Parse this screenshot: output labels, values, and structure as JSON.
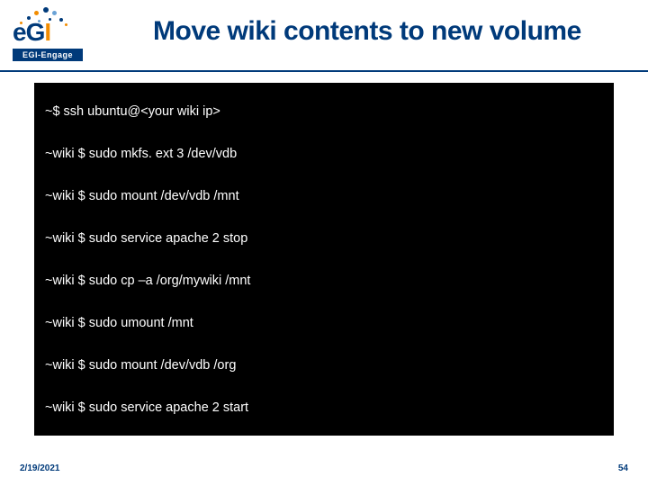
{
  "logo": {
    "brand": "eGI",
    "engage_label": "EGI-Engage"
  },
  "title": "Move wiki contents to new volume",
  "terminal": {
    "lines": [
      "~$ ssh ubuntu@<your wiki ip>",
      "~wiki $ sudo mkfs. ext 3 /dev/vdb",
      "~wiki $ sudo mount /dev/vdb /mnt",
      "~wiki $ sudo service apache 2 stop",
      "~wiki $ sudo cp –a /org/mywiki /mnt",
      "~wiki $ sudo umount /mnt",
      "~wiki $ sudo mount /dev/vdb /org",
      "~wiki $ sudo service apache 2 start"
    ]
  },
  "footer": {
    "date": "2/19/2021",
    "page": "54"
  },
  "colors": {
    "brand_blue": "#003a7a",
    "brand_orange": "#f28c00"
  }
}
